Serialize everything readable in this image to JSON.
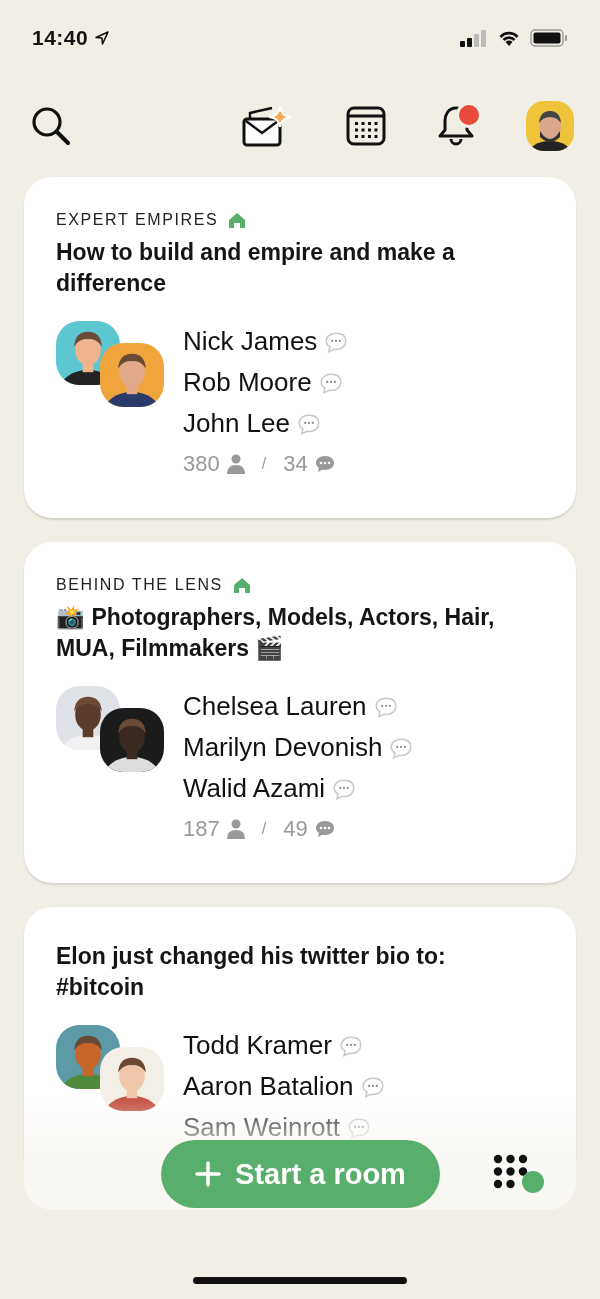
{
  "status_bar": {
    "time": "14:40"
  },
  "header": {
    "bell": {
      "has_notification": true
    }
  },
  "rooms": [
    {
      "club": "EXPERT EMPIRES",
      "title": "How to build and empire and make a difference",
      "speakers": [
        "Nick James",
        "Rob Moore",
        "John Lee"
      ],
      "listeners": "380",
      "separator": "/",
      "chats": "34"
    },
    {
      "club": "BEHIND THE LENS",
      "title": "📸 Photographers, Models, Actors, Hair, MUA, Filmmakers 🎬",
      "speakers": [
        "Chelsea Lauren",
        "Marilyn Devonish",
        "Walid Azami"
      ],
      "listeners": "187",
      "separator": "/",
      "chats": "49"
    },
    {
      "title": "Elon just changed his twitter bio to: #bitcoin",
      "speakers": [
        "Todd Kramer",
        "Aaron Batalion",
        "Sam Weinrott"
      ]
    }
  ],
  "start_button": {
    "label": "Start a room"
  },
  "online_indicator": {
    "online": true
  }
}
